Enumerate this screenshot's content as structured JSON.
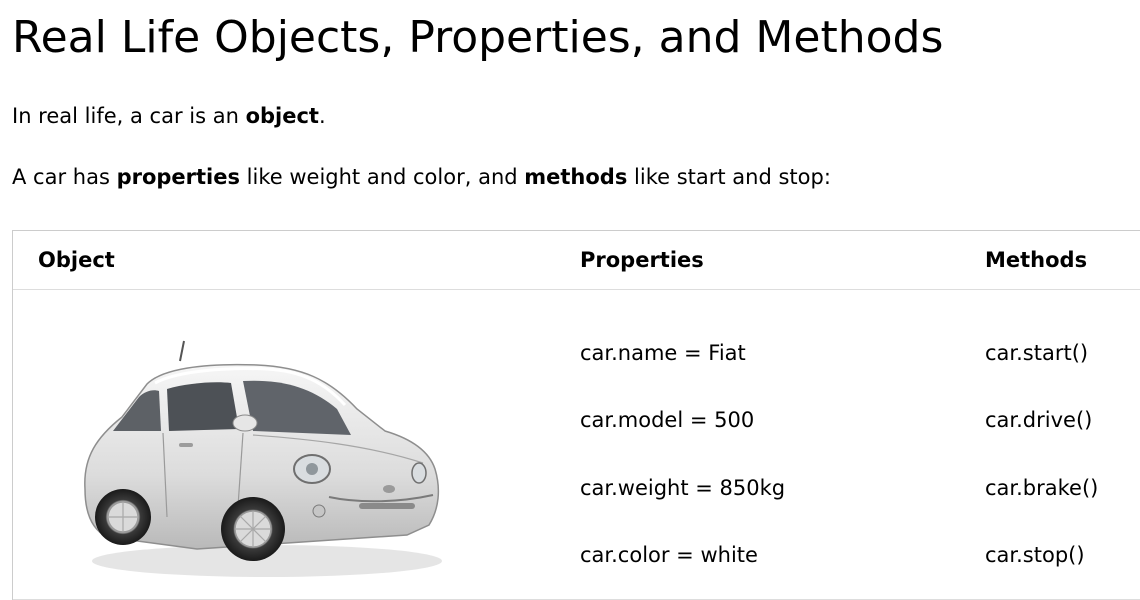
{
  "title": "Real Life Objects, Properties, and Methods",
  "intro": {
    "p1_prefix": "In real life, a car is an ",
    "p1_bold": "object",
    "p1_suffix": ".",
    "p2_prefix": "A car has ",
    "p2_bold1": "properties",
    "p2_middle": " like weight and color, and ",
    "p2_bold2": "methods",
    "p2_suffix": " like start and stop:"
  },
  "table": {
    "headers": [
      "Object",
      "Properties",
      "Methods"
    ],
    "properties": [
      "car.name = Fiat",
      "car.model = 500",
      "car.weight = 850kg",
      "car.color = white"
    ],
    "methods": [
      "car.start()",
      "car.drive()",
      "car.brake()",
      "car.stop()"
    ]
  },
  "image": {
    "subject": "white-fiat-500-car",
    "body_color": "#e9e9e9"
  }
}
